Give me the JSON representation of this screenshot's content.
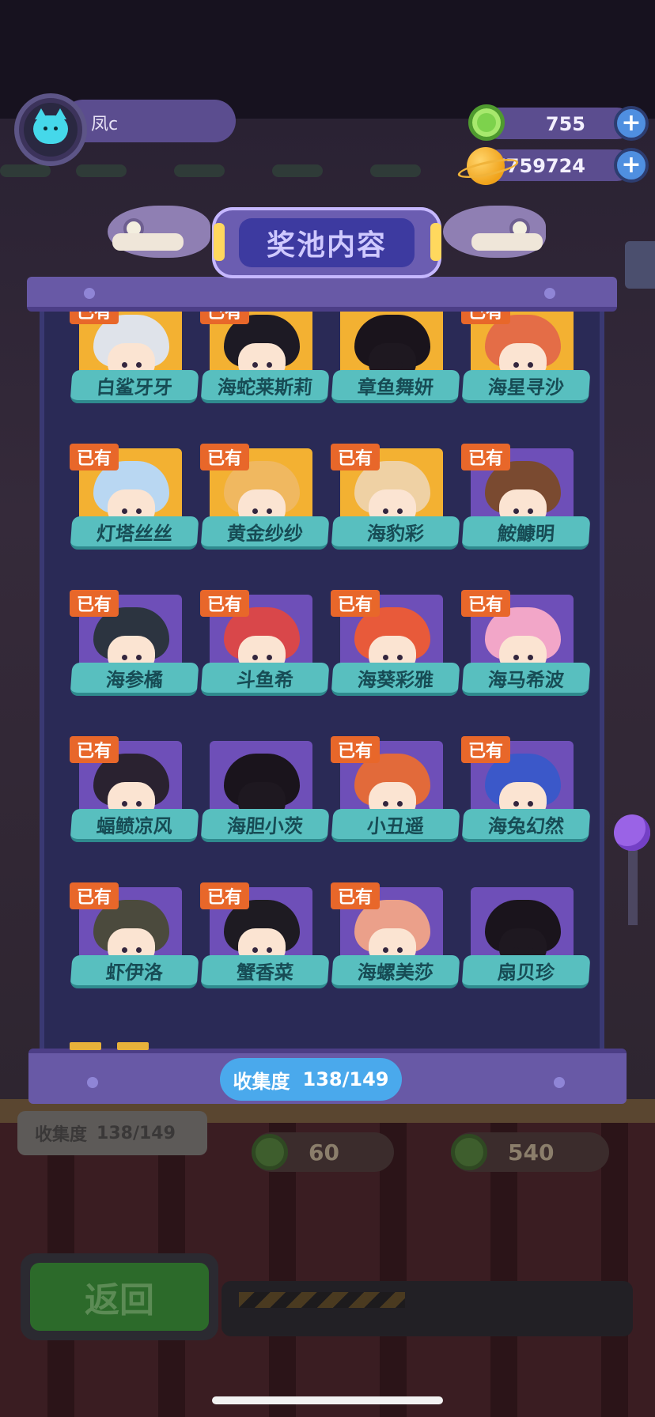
{
  "header": {
    "player_name": "凤c",
    "avatar_icon": "cat-icon",
    "gems": "755",
    "coins": "7759724",
    "add_label": "+"
  },
  "panel": {
    "title": "奖池内容",
    "owned_label": "已有",
    "collect_label": "收集度",
    "collect_value": "138/149"
  },
  "characters": [
    {
      "name": "白鲨牙牙",
      "owned": true,
      "rarity": "gold",
      "hair": "#dfe3ea"
    },
    {
      "name": "海蛇莱斯莉",
      "owned": true,
      "rarity": "gold",
      "hair": "#1d1a24"
    },
    {
      "name": "章鱼舞妍",
      "owned": false,
      "rarity": "gold",
      "hair": "#2b1b1e"
    },
    {
      "name": "海星寻沙",
      "owned": true,
      "rarity": "gold",
      "hair": "#e46d47"
    },
    {
      "name": "灯塔丝丝",
      "owned": true,
      "rarity": "gold",
      "hair": "#b9d7f2"
    },
    {
      "name": "黄金纱纱",
      "owned": true,
      "rarity": "gold",
      "hair": "#f0b860"
    },
    {
      "name": "海豹彩",
      "owned": true,
      "rarity": "gold",
      "hair": "#efd1a4"
    },
    {
      "name": "鮟鱇明",
      "owned": true,
      "rarity": "purple",
      "hair": "#7a4a30"
    },
    {
      "name": "海参橘",
      "owned": true,
      "rarity": "purple",
      "hair": "#2c3440"
    },
    {
      "name": "斗鱼希",
      "owned": true,
      "rarity": "purple",
      "hair": "#d9474a"
    },
    {
      "name": "海葵彩雅",
      "owned": true,
      "rarity": "purple",
      "hair": "#e85a3a"
    },
    {
      "name": "海马希波",
      "owned": true,
      "rarity": "purple",
      "hair": "#f2a6c8"
    },
    {
      "name": "蝠鲼凉风",
      "owned": true,
      "rarity": "purple",
      "hair": "#2a2230"
    },
    {
      "name": "海胆小茨",
      "owned": false,
      "rarity": "purple",
      "hair": "#2c2218"
    },
    {
      "name": "小丑遥",
      "owned": true,
      "rarity": "purple",
      "hair": "#e26a3a"
    },
    {
      "name": "海兔幻然",
      "owned": true,
      "rarity": "purple",
      "hair": "#3b58c9"
    },
    {
      "name": "虾伊洛",
      "owned": true,
      "rarity": "purple",
      "hair": "#4b4a3d"
    },
    {
      "name": "蟹香菜",
      "owned": true,
      "rarity": "purple",
      "hair": "#1e1b22"
    },
    {
      "name": "海螺美莎",
      "owned": true,
      "rarity": "purple",
      "hair": "#eba08a"
    },
    {
      "name": "扇贝珍",
      "owned": false,
      "rarity": "purple",
      "hair": "#1c1517"
    }
  ],
  "background": {
    "collect_label": "收集度",
    "collect_value": "138/149",
    "cost_single": "60",
    "cost_multi": "540",
    "back_label": "返回"
  },
  "colors": {
    "gold_card": "#f3b132",
    "purple_card": "#6e4fb8",
    "name_plate": "#58bfbf",
    "owned_tag": "#e8672a",
    "collect_pill": "#4aa9ec"
  }
}
